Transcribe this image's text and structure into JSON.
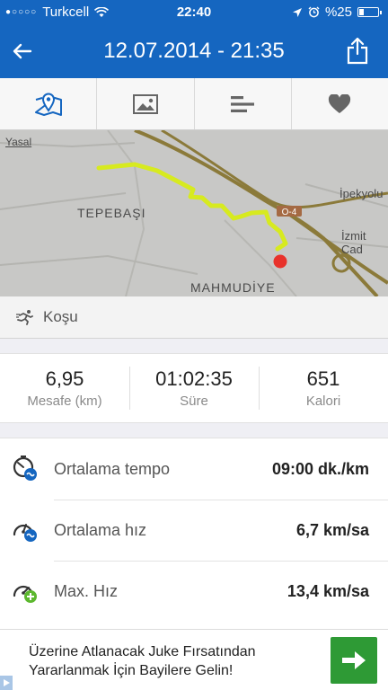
{
  "status_bar": {
    "carrier": "Turkcell",
    "signal_dots": "●○○○○",
    "time": "22:40",
    "battery_text": "%25",
    "battery_level": 0.25
  },
  "nav": {
    "title": "12.07.2014 - 21:35",
    "back_icon": "arrow-left-icon",
    "share_icon": "share-icon"
  },
  "tabs": [
    {
      "name": "map-tab",
      "icon": "map-pin-icon",
      "active": true
    },
    {
      "name": "photos-tab",
      "icon": "image-icon",
      "active": false
    },
    {
      "name": "splits-tab",
      "icon": "list-bars-icon",
      "active": false
    },
    {
      "name": "heart-tab",
      "icon": "heart-icon",
      "active": false
    }
  ],
  "map": {
    "labels": {
      "yasal": "Yasal",
      "tepebasi": "TEPEBAŞI",
      "ipekyolu": "İpekyolu",
      "izmit": "İzmit Cad",
      "mahmudiye": "MAHMUDİYE",
      "road_shield": "O-4"
    },
    "route_color": "#d7ea1f",
    "end_marker_color": "#e8322b"
  },
  "activity": {
    "icon": "running-icon",
    "label": "Koşu"
  },
  "summary": [
    {
      "value": "6,95",
      "label": "Mesafe (km)"
    },
    {
      "value": "01:02:35",
      "label": "Süre"
    },
    {
      "value": "651",
      "label": "Kalori"
    }
  ],
  "details": [
    {
      "label": "Ortalama tempo",
      "value": "09:00 dk./km",
      "icon": "stopwatch-pace-icon"
    },
    {
      "label": "Ortalama hız",
      "value": "6,7 km/sa",
      "icon": "speedometer-avg-icon"
    },
    {
      "label": "Max. Hız",
      "value": "13,4 km/sa",
      "icon": "speedometer-max-icon"
    }
  ],
  "ad": {
    "text_line1": "Üzerine Atlanacak Juke Fırsatından",
    "text_line2": "Yararlanmak İçin Bayilere Gelin!",
    "button_icon": "arrow-right-icon",
    "accent_color": "#2e9a35"
  },
  "colors": {
    "header": "#1566c0",
    "icon_blue": "#1566c0"
  }
}
